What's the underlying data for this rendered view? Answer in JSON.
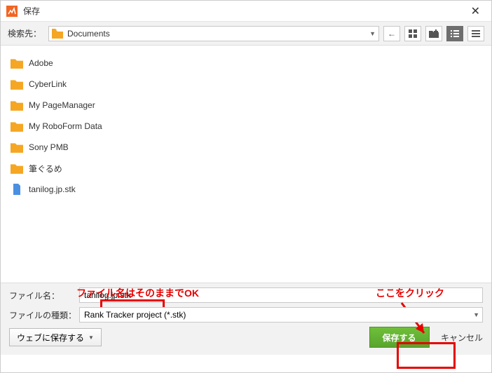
{
  "title": "保存",
  "search_label": "検索先：",
  "location": "Documents",
  "files": [
    {
      "name": "Adobe",
      "type": "folder"
    },
    {
      "name": "CyberLink",
      "type": "folder"
    },
    {
      "name": "My PageManager",
      "type": "folder"
    },
    {
      "name": "My RoboForm Data",
      "type": "folder"
    },
    {
      "name": "Sony PMB",
      "type": "folder"
    },
    {
      "name": "筆ぐるめ",
      "type": "folder"
    },
    {
      "name": "tanilog.jp.stk",
      "type": "file"
    }
  ],
  "annotation_filename": "ファイル名はそのままでOK",
  "annotation_click": "ここをクリック",
  "filename_label": "ファイル名：",
  "filename_value": "tanilog.jp.stk",
  "filetype_label": "ファイルの種類：",
  "filetype_value": "Rank Tracker project (*.stk)",
  "websave": "ウェブに保存する",
  "save": "保存する",
  "cancel": "キャンセル"
}
